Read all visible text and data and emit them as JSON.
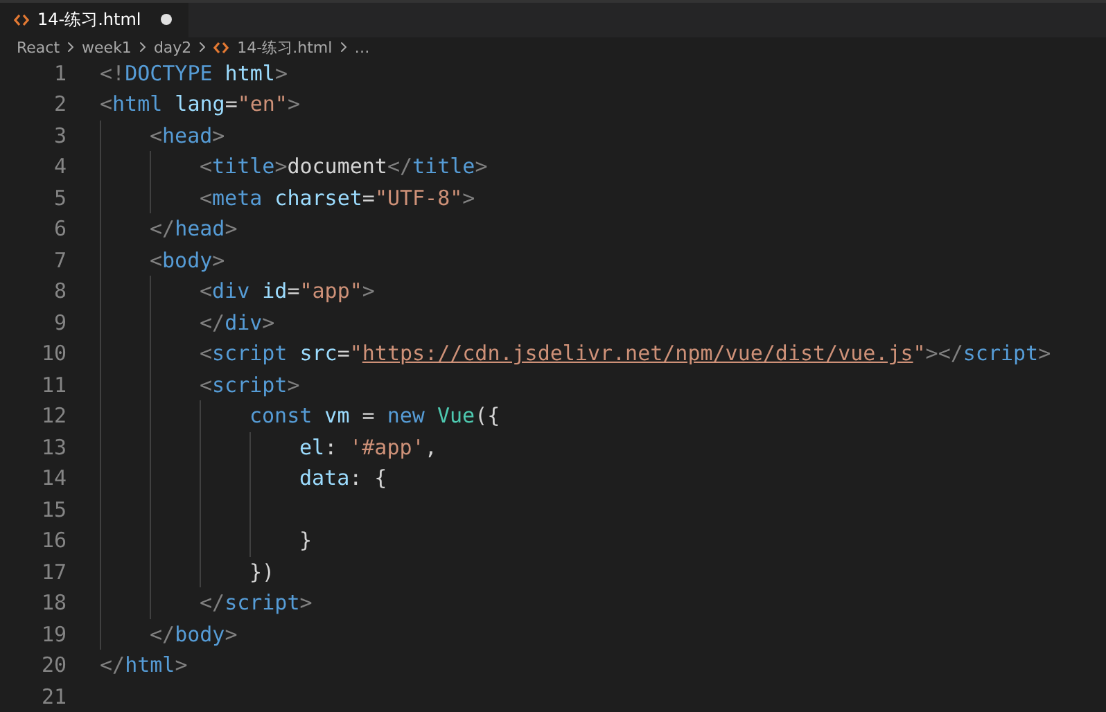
{
  "tabs": [
    {
      "label": "14-练习.html",
      "selected": true,
      "modified": true
    }
  ],
  "breadcrumb": {
    "items": [
      "React",
      "week1",
      "day2"
    ],
    "file": "14-练习.html",
    "more": "…"
  },
  "lines": [
    {
      "number": "1",
      "tokens": [
        {
          "kind": "punct",
          "text": "<!"
        },
        {
          "kind": "tag",
          "text": "DOCTYPE"
        },
        {
          "kind": "attr",
          "text": " html"
        },
        {
          "kind": "punct",
          "text": ">"
        }
      ]
    },
    {
      "number": "2",
      "tokens": [
        {
          "kind": "punct",
          "text": "<"
        },
        {
          "kind": "tag",
          "text": "html"
        },
        {
          "kind": "attr",
          "text": " lang"
        },
        {
          "kind": "text",
          "text": "="
        },
        {
          "kind": "string",
          "text": "\"en\""
        },
        {
          "kind": "punct",
          "text": ">"
        }
      ],
      "children": [
        {
          "number": "3",
          "tokens": [
            {
              "kind": "punct",
              "text": "<"
            },
            {
              "kind": "tag",
              "text": "head"
            },
            {
              "kind": "punct",
              "text": ">"
            }
          ],
          "children": [
            {
              "number": "4",
              "tokens": [
                {
                  "kind": "punct",
                  "text": "<"
                },
                {
                  "kind": "tag",
                  "text": "title"
                },
                {
                  "kind": "punct",
                  "text": ">"
                },
                {
                  "kind": "text",
                  "text": "document"
                },
                {
                  "kind": "punct",
                  "text": "</"
                },
                {
                  "kind": "tag",
                  "text": "title"
                },
                {
                  "kind": "punct",
                  "text": ">"
                }
              ]
            },
            {
              "number": "5",
              "tokens": [
                {
                  "kind": "punct",
                  "text": "<"
                },
                {
                  "kind": "tag",
                  "text": "meta"
                },
                {
                  "kind": "attr",
                  "text": " charset"
                },
                {
                  "kind": "text",
                  "text": "="
                },
                {
                  "kind": "string",
                  "text": "\"UTF-8\""
                },
                {
                  "kind": "punct",
                  "text": ">"
                }
              ]
            }
          ]
        },
        {
          "number": "6",
          "tokens": [
            {
              "kind": "punct",
              "text": "</"
            },
            {
              "kind": "tag",
              "text": "head"
            },
            {
              "kind": "punct",
              "text": ">"
            }
          ]
        },
        {
          "number": "7",
          "tokens": [
            {
              "kind": "punct",
              "text": "<"
            },
            {
              "kind": "tag",
              "text": "body"
            },
            {
              "kind": "punct",
              "text": ">"
            }
          ],
          "children": [
            {
              "number": "8",
              "tokens": [
                {
                  "kind": "punct",
                  "text": "<"
                },
                {
                  "kind": "tag",
                  "text": "div"
                },
                {
                  "kind": "attr",
                  "text": " id"
                },
                {
                  "kind": "text",
                  "text": "="
                },
                {
                  "kind": "string",
                  "text": "\"app\""
                },
                {
                  "kind": "punct",
                  "text": ">"
                }
              ]
            },
            {
              "number": "9",
              "tokens": [
                {
                  "kind": "punct",
                  "text": "</"
                },
                {
                  "kind": "tag",
                  "text": "div"
                },
                {
                  "kind": "punct",
                  "text": ">"
                }
              ]
            },
            {
              "number": "10",
              "tokens": [
                {
                  "kind": "punct",
                  "text": "<"
                },
                {
                  "kind": "tag",
                  "text": "script"
                },
                {
                  "kind": "attr",
                  "text": " src"
                },
                {
                  "kind": "text",
                  "text": "="
                },
                {
                  "kind": "string",
                  "text": "\""
                },
                {
                  "kind": "link",
                  "text": "https://cdn.jsdelivr.net/npm/vue/dist/vue.js"
                },
                {
                  "kind": "string",
                  "text": "\""
                },
                {
                  "kind": "punct",
                  "text": "></"
                },
                {
                  "kind": "tag",
                  "text": "script"
                },
                {
                  "kind": "punct",
                  "text": ">"
                }
              ]
            },
            {
              "number": "11",
              "tokens": [
                {
                  "kind": "punct",
                  "text": "<"
                },
                {
                  "kind": "tag",
                  "text": "script"
                },
                {
                  "kind": "punct",
                  "text": ">"
                }
              ],
              "children": [
                {
                  "number": "12",
                  "tokens": [
                    {
                      "kind": "keyword",
                      "text": "const"
                    },
                    {
                      "kind": "var",
                      "text": " vm"
                    },
                    {
                      "kind": "text",
                      "text": " = "
                    },
                    {
                      "kind": "keyword",
                      "text": "new"
                    },
                    {
                      "kind": "class",
                      "text": " Vue"
                    },
                    {
                      "kind": "text",
                      "text": "({"
                    }
                  ],
                  "children": [
                    {
                      "number": "13",
                      "tokens": [
                        {
                          "kind": "var",
                          "text": "el"
                        },
                        {
                          "kind": "text",
                          "text": ": "
                        },
                        {
                          "kind": "string",
                          "text": "'#app'"
                        },
                        {
                          "kind": "text",
                          "text": ","
                        }
                      ]
                    },
                    {
                      "number": "14",
                      "tokens": [
                        {
                          "kind": "var",
                          "text": "data"
                        },
                        {
                          "kind": "text",
                          "text": ": {"
                        }
                      ]
                    },
                    {
                      "number": "15"
                    },
                    {
                      "number": "16",
                      "tokens": [
                        {
                          "kind": "text",
                          "text": "}"
                        }
                      ]
                    }
                  ]
                },
                {
                  "number": "17",
                  "tokens": [
                    {
                      "kind": "text",
                      "text": "})"
                    }
                  ]
                }
              ]
            },
            {
              "number": "18",
              "tokens": [
                {
                  "kind": "punct",
                  "text": "</"
                },
                {
                  "kind": "tag",
                  "text": "script"
                },
                {
                  "kind": "punct",
                  "text": ">"
                }
              ]
            }
          ]
        },
        {
          "number": "19",
          "tokens": [
            {
              "kind": "punct",
              "text": "</"
            },
            {
              "kind": "tag",
              "text": "body"
            },
            {
              "kind": "punct",
              "text": ">"
            }
          ]
        }
      ]
    },
    {
      "number": "20",
      "tokens": [
        {
          "kind": "punct",
          "text": "</"
        },
        {
          "kind": "tag",
          "text": "html"
        },
        {
          "kind": "punct",
          "text": ">"
        }
      ]
    },
    {
      "number": "21"
    }
  ]
}
